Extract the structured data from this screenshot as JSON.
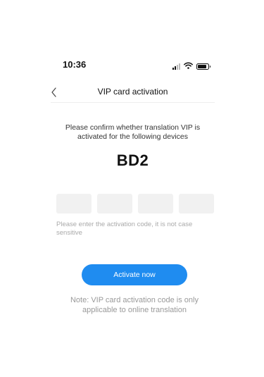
{
  "status_bar": {
    "time": "10:36",
    "icons": [
      "cellular-signal-icon",
      "wifi-icon",
      "battery-icon"
    ],
    "battery_level": 0.85
  },
  "nav": {
    "back_icon": "chevron-left-icon",
    "title": "VIP card activation"
  },
  "content": {
    "confirm_text": "Please confirm whether translation VIP is activated for the following devices",
    "device_name": "BD2",
    "code_boxes": [
      "",
      "",
      "",
      ""
    ],
    "hint": "Please enter the activation code, it is not case sensitive",
    "activate_label": "Activate now",
    "note": "Note: VIP card activation code is only applicable to online translation"
  },
  "colors": {
    "accent": "#1f8cf0",
    "input_bg": "#f1f1f1",
    "hint_text": "#aaaaaa"
  }
}
